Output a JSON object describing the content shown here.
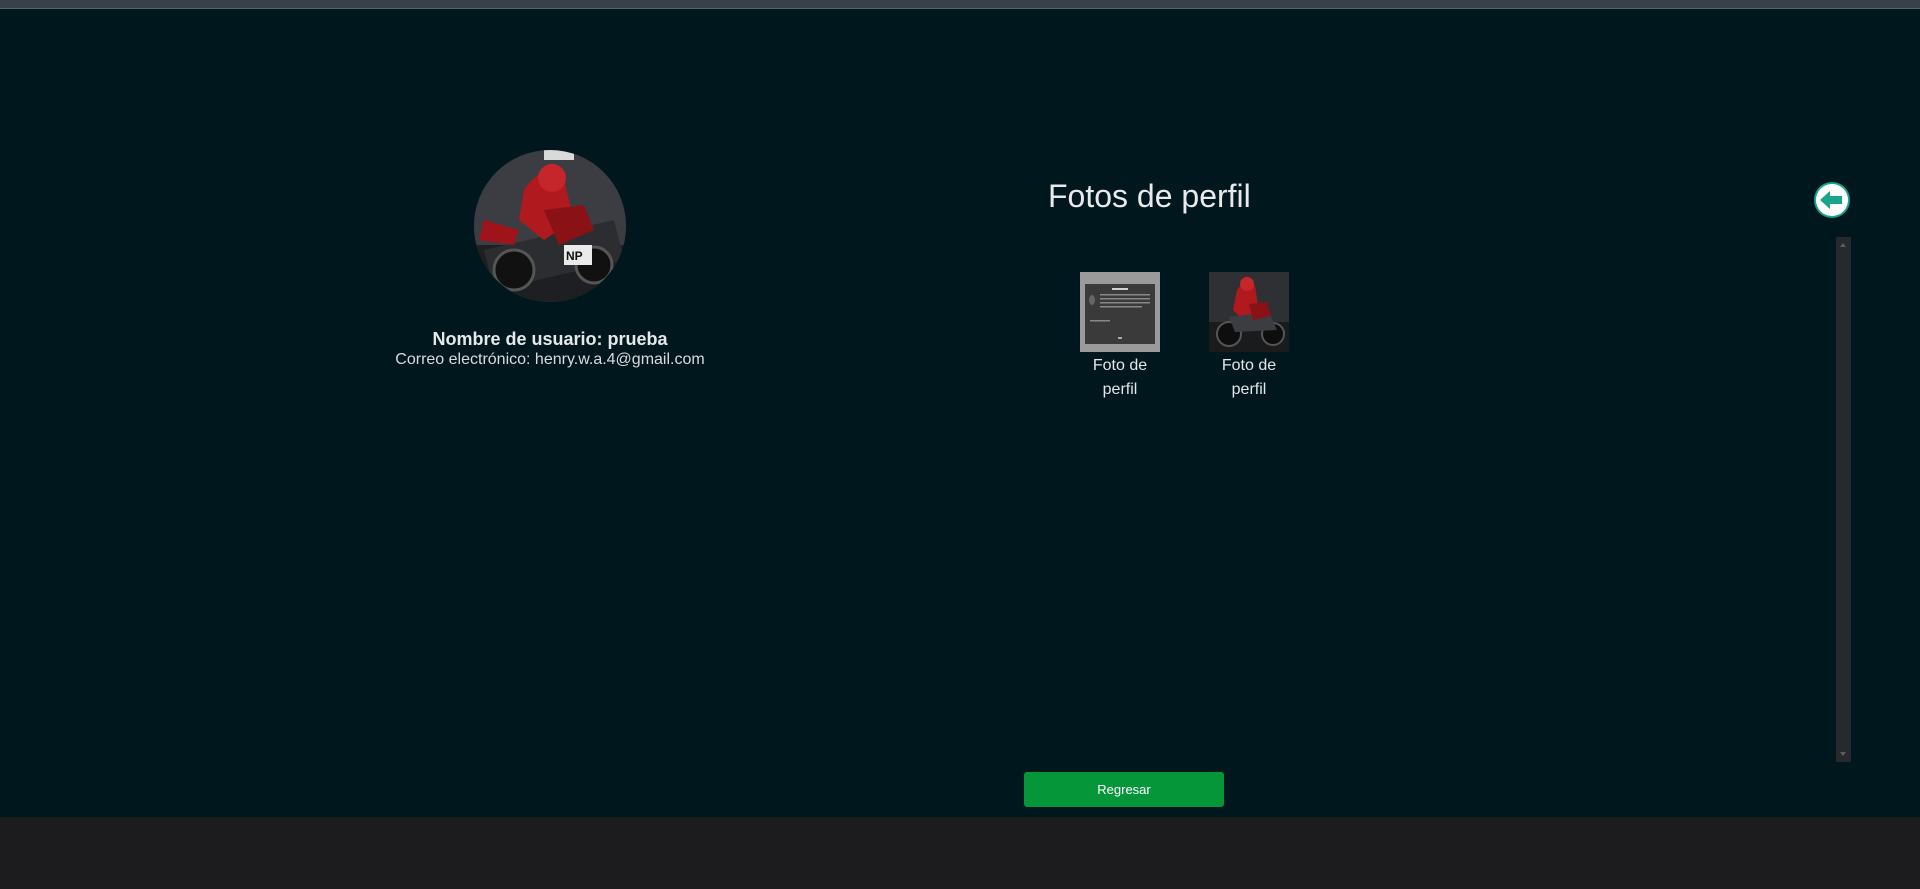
{
  "profile": {
    "username_label": "Nombre de usuario: prueba",
    "email_label": "Correo electrónico: henry.w.a.4@gmail.com",
    "avatar_icon": "profile-photo-motorcycle-rider"
  },
  "gallery": {
    "title": "Fotos de perfil",
    "back_icon": "arrow-left-circle-icon",
    "photos": [
      {
        "caption": "Foto de perfil",
        "thumbnail": "document-screenshot"
      },
      {
        "caption": "Foto de perfil",
        "thumbnail": "motorcycle-rider"
      }
    ]
  },
  "actions": {
    "regresar_label": "Regresar"
  },
  "colors": {
    "background": "#01171e",
    "accent": "#05963a",
    "back_icon": "#1aa58a"
  }
}
